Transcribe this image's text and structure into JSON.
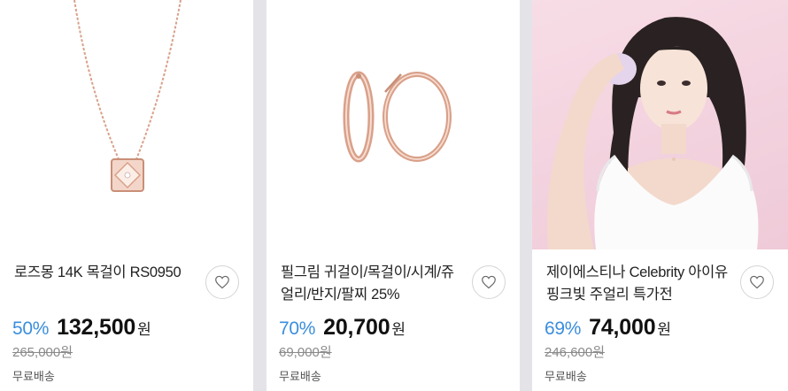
{
  "products": [
    {
      "title": "로즈몽 14K 목걸이 RS0950",
      "discount": "50%",
      "price": "132,500",
      "currency": "원",
      "original_price": "265,000원",
      "shipping": "무료배송",
      "image_icon": "necklace-image"
    },
    {
      "title": "필그림 귀걸이/목걸이/시계/쥬얼리/반지/팔찌 25%",
      "discount": "70%",
      "price": "20,700",
      "currency": "원",
      "original_price": "69,000원",
      "shipping": "무료배송",
      "image_icon": "hoop-earrings-image"
    },
    {
      "title": "제이에스티나 Celebrity 아이유 핑크빛 주얼리 특가전",
      "discount": "69%",
      "price": "74,000",
      "currency": "원",
      "original_price": "246,600원",
      "shipping": "무료배송",
      "image_icon": "model-photo-image"
    }
  ],
  "colors": {
    "discount": "#3b8ede",
    "price": "#111111",
    "background": "#e4e4e8",
    "rose_gold": "#d9a08a"
  }
}
